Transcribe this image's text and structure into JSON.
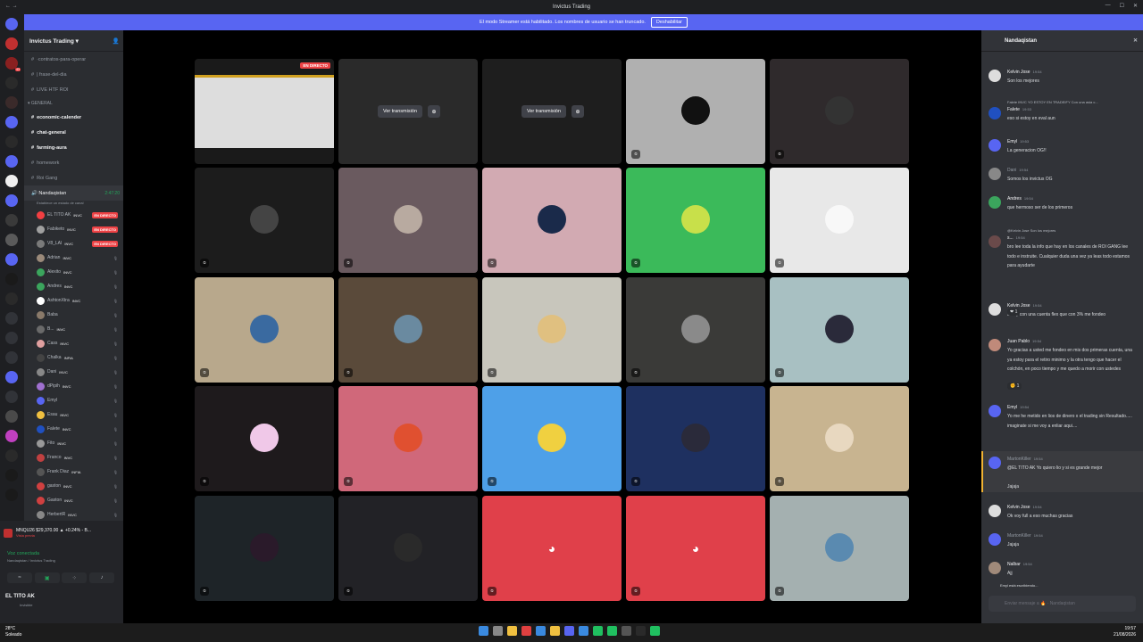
{
  "window": {
    "title": "Invictus Trading"
  },
  "notice": {
    "text": "El modo Streamer está habilitado. Los nombres de usuario se han truncado.",
    "button": "Deshabilitar"
  },
  "guild": {
    "name": "Invictus Trading"
  },
  "channels": [
    {
      "label": "·contratos-para-operar",
      "bold": false
    },
    {
      "label": "| frase-del-dia",
      "bold": false
    },
    {
      "label": "LIVE HTF ROI",
      "bold": false
    }
  ],
  "category": "GENERAL",
  "channels2": [
    {
      "label": "economic-calender",
      "bold": true
    },
    {
      "label": "chat-general",
      "bold": true
    },
    {
      "label": "farming-aura",
      "bold": true
    },
    {
      "label": "homework",
      "bold": false
    },
    {
      "label": "Roi Gang",
      "bold": false
    }
  ],
  "voice_channel": {
    "name": "Nandaqistan",
    "time": "2:47:20",
    "status": "Establece un estado de canal"
  },
  "members": [
    {
      "name": "EL TITO AK",
      "tag": "INVC",
      "live": "EN DIRECTO",
      "color": "#f23f42"
    },
    {
      "name": "Fabiketo",
      "tag": "INVC",
      "live": "EN DIRECTO",
      "color": "#a0a0a0"
    },
    {
      "name": "V8_LAI",
      "tag": "INVC",
      "live": "EN DIRECTO",
      "color": "#7a7a7a"
    },
    {
      "name": "Adrian",
      "tag": "INVC",
      "live": "",
      "color": "#9b8a7a"
    },
    {
      "name": "Alexito",
      "tag": "INVC",
      "live": "",
      "color": "#3ba55d"
    },
    {
      "name": "Andres",
      "tag": "INVC",
      "live": "",
      "color": "#3ba55d"
    },
    {
      "name": "AshtonXtra",
      "tag": "INVC",
      "live": "",
      "color": "#ffffff"
    },
    {
      "name": "Baba",
      "tag": "",
      "live": "",
      "color": "#8a7a6a"
    },
    {
      "name": "B...",
      "tag": "INVC",
      "live": "",
      "color": "#6a6a6a"
    },
    {
      "name": "Cass",
      "tag": "INVC",
      "live": "",
      "color": "#e0a0a0"
    },
    {
      "name": "Chalka",
      "tag": "INFIA",
      "live": "",
      "color": "#444"
    },
    {
      "name": "Dani",
      "tag": "INVC",
      "live": "",
      "color": "#888"
    },
    {
      "name": "dPipih",
      "tag": "INVC",
      "live": "",
      "color": "#a070d0"
    },
    {
      "name": "Emyl",
      "tag": "",
      "live": "",
      "color": "#5865f2"
    },
    {
      "name": "Esau",
      "tag": "INVC",
      "live": "",
      "color": "#f0c040"
    },
    {
      "name": "Falete",
      "tag": "INVC",
      "live": "",
      "color": "#2050c0"
    },
    {
      "name": "Fito",
      "tag": "INVC",
      "live": "",
      "color": "#999"
    },
    {
      "name": "Franco",
      "tag": "INVC",
      "live": "",
      "color": "#c04040"
    },
    {
      "name": "Frank Diaz",
      "tag": "INFIA",
      "live": "",
      "color": "#555"
    },
    {
      "name": "gaston",
      "tag": "INVC",
      "live": "",
      "color": "#d04040"
    },
    {
      "name": "Gaston",
      "tag": "INVC",
      "live": "",
      "color": "#d04040"
    },
    {
      "name": "HerbertR",
      "tag": "INVC",
      "live": "",
      "color": "#888"
    }
  ],
  "ticker": {
    "text": "MNQU26 $29,370.00 ▲ +0.24% - B...",
    "sub": "Vista previa"
  },
  "voice": {
    "connected": "Voz conectada",
    "where": "Nandaqistan / Invictus Trading"
  },
  "me": {
    "name": "EL TITO AK",
    "status": "Invisible"
  },
  "tiles": {
    "watch_label": "Ver transmisión",
    "live_label": "EN DIRECTO",
    "items": [
      {
        "bg": "#1a1a1a",
        "kind": "screen"
      },
      {
        "bg": "#2a2a2a",
        "kind": "watch"
      },
      {
        "bg": "#1e1e1e",
        "kind": "watch"
      },
      {
        "bg": "#b0b0b0",
        "kind": "avatar",
        "av": "#111"
      },
      {
        "bg": "#2f2a2c",
        "kind": "avatar",
        "av": "#333"
      },
      {
        "bg": "#1c1c1c",
        "kind": "avatar",
        "av": "#444"
      },
      {
        "bg": "#6a5a5f",
        "kind": "avatar",
        "av": "#b8aaa0"
      },
      {
        "bg": "#d2aab2",
        "kind": "avatar",
        "av": "#1a2a4a"
      },
      {
        "bg": "#3bba5a",
        "kind": "avatar",
        "av": "#c8e04a"
      },
      {
        "bg": "#e8e8e8",
        "kind": "avatar",
        "av": "#f8f8f8"
      },
      {
        "bg": "#b8a88c",
        "kind": "avatar",
        "av": "#3a6aa0"
      },
      {
        "bg": "#5a4a3a",
        "kind": "avatar",
        "av": "#6a8aa0"
      },
      {
        "bg": "#c8c6bc",
        "kind": "avatar",
        "av": "#e0c080"
      },
      {
        "bg": "#3a3a38",
        "kind": "avatar",
        "av": "#8a8a8a"
      },
      {
        "bg": "#a8c0c2",
        "kind": "avatar",
        "av": "#2a2a3a"
      },
      {
        "bg": "#1e1a1c",
        "kind": "avatar",
        "av": "#f0c8e8"
      },
      {
        "bg": "#d0687a",
        "kind": "avatar",
        "av": "#e05030"
      },
      {
        "bg": "#4ea0e8",
        "kind": "avatar",
        "av": "#f0d040"
      },
      {
        "bg": "#1e3060",
        "kind": "avatar",
        "av": "#2a2a3a"
      },
      {
        "bg": "#c8b490",
        "kind": "avatar",
        "av": "#e8d8c0"
      },
      {
        "bg": "#1e2428",
        "kind": "avatar",
        "av": "#2a1a2a"
      },
      {
        "bg": "#222226",
        "kind": "avatar",
        "av": "#2a2a2a"
      },
      {
        "bg": "#e0404a",
        "kind": "discord"
      },
      {
        "bg": "#e0404a",
        "kind": "discord"
      },
      {
        "bg": "#a4b0b0",
        "kind": "avatar",
        "av": "#5a8ab0"
      }
    ]
  },
  "chat": {
    "title": "Nandaqistan",
    "messages": [
      {
        "name": "Kelvin Jose",
        "time": "19:54",
        "text": "Son los mejores",
        "color": "#f2f3f5",
        "av": "#ddd"
      },
      {
        "reply": "Falete INVC YO ESTOY EN TRADEIFY Con una asia c...",
        "name": "Falete",
        "time": "19:53",
        "text": "eso si estoy en eval aun",
        "color": "#f2f3f5",
        "av": "#2050c0"
      },
      {
        "name": "Emyl",
        "time": "19:53",
        "text": "La generacion OG!!",
        "color": "#f2f3f5",
        "av": "#5865f2"
      },
      {
        "name": "Dani",
        "time": "19:54",
        "text": "Somos los invictus OG",
        "color": "#949ba4",
        "av": "#888"
      },
      {
        "name": "Andres",
        "time": "19:54",
        "text": "que hermoso ser de los primeros",
        "color": "#f2f3f5",
        "av": "#3ba55d"
      },
      {
        "reply": "@Kelvin Jose Son los mejores",
        "name": "s...",
        "time": "19:54",
        "text": "bro lee toda la info que hay en los canales de ROI GANG lee todo e instruite. Cualquier duda una vez ya leas todo estamos para ayudarte",
        "color": "#f2f3f5",
        "av": "#6a4a4a"
      },
      {
        "name": "Kelvin Jose",
        "time": "19:54",
        "text": "Estoy con una cuenta flex que con 3% me fondeo",
        "color": "#f2f3f5",
        "av": "#ddd"
      },
      {
        "name": "Juan Pablo",
        "time": "19:54",
        "text": "Yo gracias a usted me fondeo en mis dos primeras cuenta, una ya estoy para el retiro minimo y la otra tengo que hacer el colchón, en poco tiempo y me quedo a morir con ustedes",
        "color": "#f2f3f5",
        "av": "#c08a7a"
      },
      {
        "name": "Emyl",
        "time": "19:54",
        "text": "Yo me he metido en lios de dinero x el trading sin Resultado..... imaginate si me voy a enliar aqui....",
        "color": "#f2f3f5",
        "av": "#5865f2"
      },
      {
        "name": "MartonKiller",
        "time": "19:54",
        "text": "@EL TITO AK Yo quiero lio y si es grande mejor",
        "text2": "Jajaja",
        "color": "#949ba4",
        "av": "#5865f2"
      },
      {
        "name": "Kelvin Jose",
        "time": "19:54",
        "text": "Ok voy full a eso muchas gracias",
        "color": "#f2f3f5",
        "av": "#ddd"
      },
      {
        "name": "MartonKiller",
        "time": "19:54",
        "text": "Jajaja",
        "color": "#949ba4",
        "av": "#5865f2"
      },
      {
        "name": "Nalbar",
        "time": "19:54",
        "text": "Ajj",
        "color": "#f2f3f5",
        "av": "#a08a7a"
      }
    ],
    "reaction1": "❤ 1",
    "reaction2": "✊ 1",
    "typing": "Emyl está escribiendo...",
    "input_placeholder": "Enviar mensaje a 🔥 · Nandaqistan"
  },
  "taskbar": {
    "temp": "28°C",
    "weather": "Soleado",
    "time": "19:57",
    "date": "21/08/2026"
  }
}
